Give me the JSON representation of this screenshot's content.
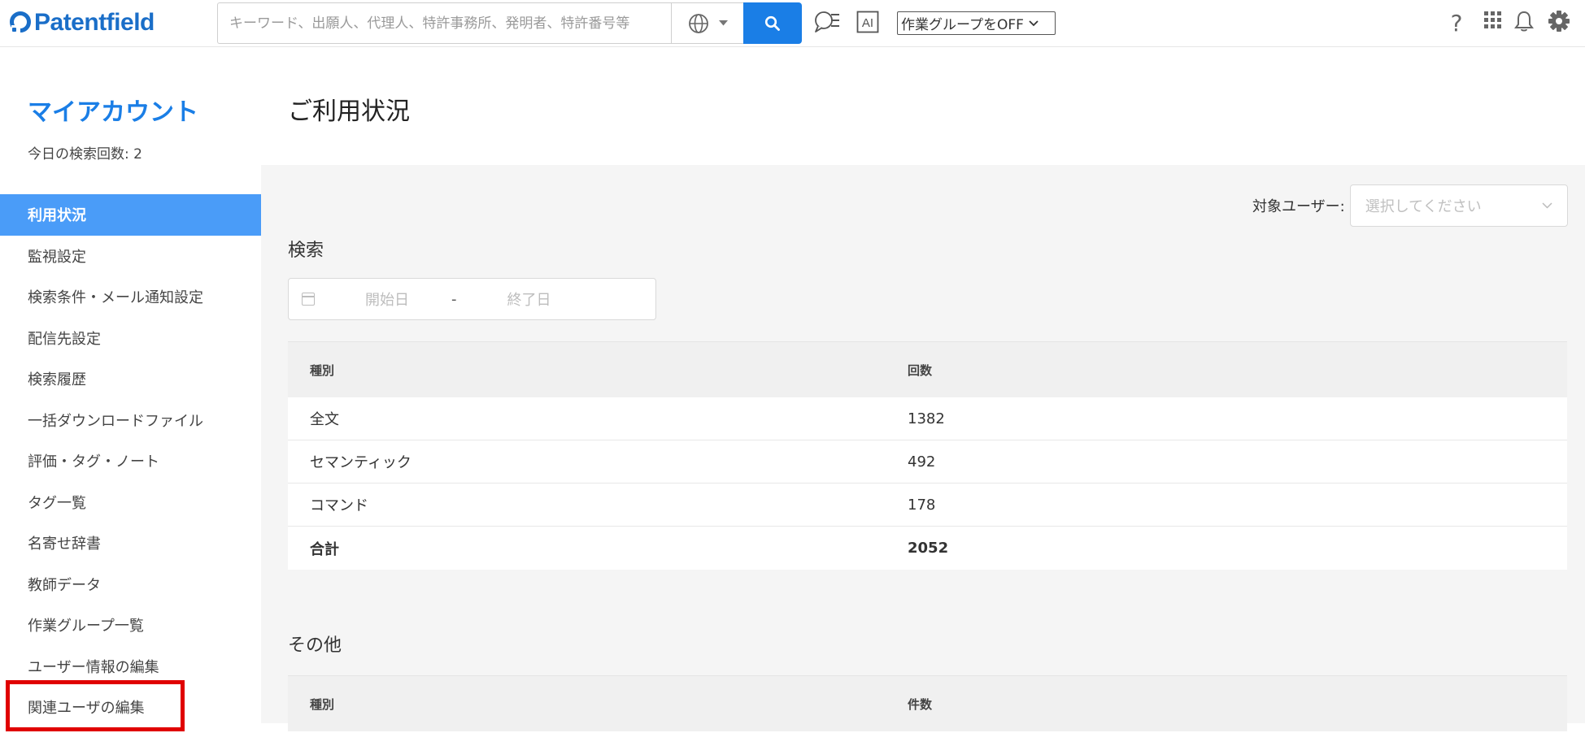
{
  "header": {
    "logo_text": "Patentfield",
    "search_placeholder": "キーワード、出願人、代理人、特許事務所、発明者、特許番号等",
    "workgroup_label": "作業グループをOFF",
    "icons": [
      "globe-icon",
      "search-icon",
      "chat-list-icon",
      "ai-icon",
      "help-icon",
      "apps-grid-icon",
      "bell-icon",
      "gear-icon"
    ]
  },
  "sidebar": {
    "title": "マイアカウント",
    "search_count": "今日の検索回数: 2",
    "items": [
      {
        "label": "利用状況",
        "active": true
      },
      {
        "label": "監視設定"
      },
      {
        "label": "検索条件・メール通知設定"
      },
      {
        "label": "配信先設定"
      },
      {
        "label": "検索履歴"
      },
      {
        "label": "一括ダウンロードファイル"
      },
      {
        "label": "評価・タグ・ノート"
      },
      {
        "label": "タグ一覧"
      },
      {
        "label": "名寄せ辞書"
      },
      {
        "label": "教師データ"
      },
      {
        "label": "作業グループ一覧"
      },
      {
        "label": "ユーザー情報の編集"
      },
      {
        "label": "関連ユーザの編集"
      }
    ]
  },
  "main": {
    "page_title": "ご利用状況",
    "target_user_label": "対象ユーザー:",
    "target_user_placeholder": "選択してください",
    "search_section": {
      "title": "検索",
      "start_placeholder": "開始日",
      "separator": "-",
      "end_placeholder": "終了日",
      "columns": [
        "種別",
        "回数"
      ],
      "rows": [
        [
          "全文",
          "1382"
        ],
        [
          "セマンティック",
          "492"
        ],
        [
          "コマンド",
          "178"
        ]
      ],
      "total": [
        "合計",
        "2052"
      ]
    },
    "other_section": {
      "title": "その他",
      "columns": [
        "種別",
        "件数"
      ]
    }
  },
  "colors": {
    "brand": "#1a6ec8",
    "accent": "#1a7ee6",
    "active_item": "#4a9cf8",
    "highlight": "#e00000"
  }
}
